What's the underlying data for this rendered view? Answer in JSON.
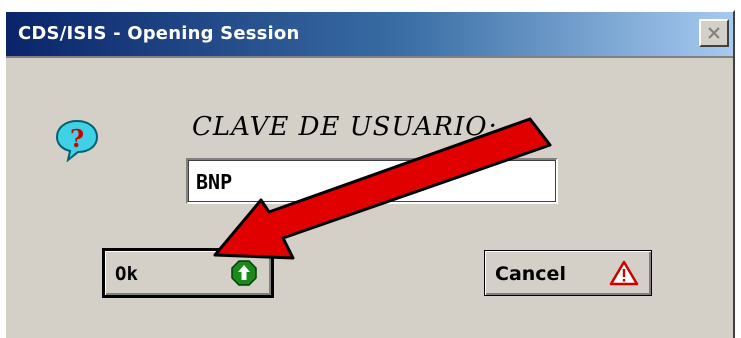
{
  "window": {
    "title": "CDS/ISIS - Opening Session"
  },
  "prompt": {
    "label": "CLAVE DE USUARIO:"
  },
  "password_field": {
    "value": "BNP"
  },
  "buttons": {
    "ok_label": "Ok",
    "cancel_label": "Cancel"
  },
  "icons": {
    "question": "question-balloon-icon",
    "ok": "green-up-arrow-icon",
    "cancel": "warning-triangle-icon",
    "close": "close-icon"
  },
  "colors": {
    "title_start": "#0a246a",
    "title_end": "#a6caf0",
    "dialog_bg": "#d4d0c8",
    "annotation_arrow": "#e00000"
  }
}
